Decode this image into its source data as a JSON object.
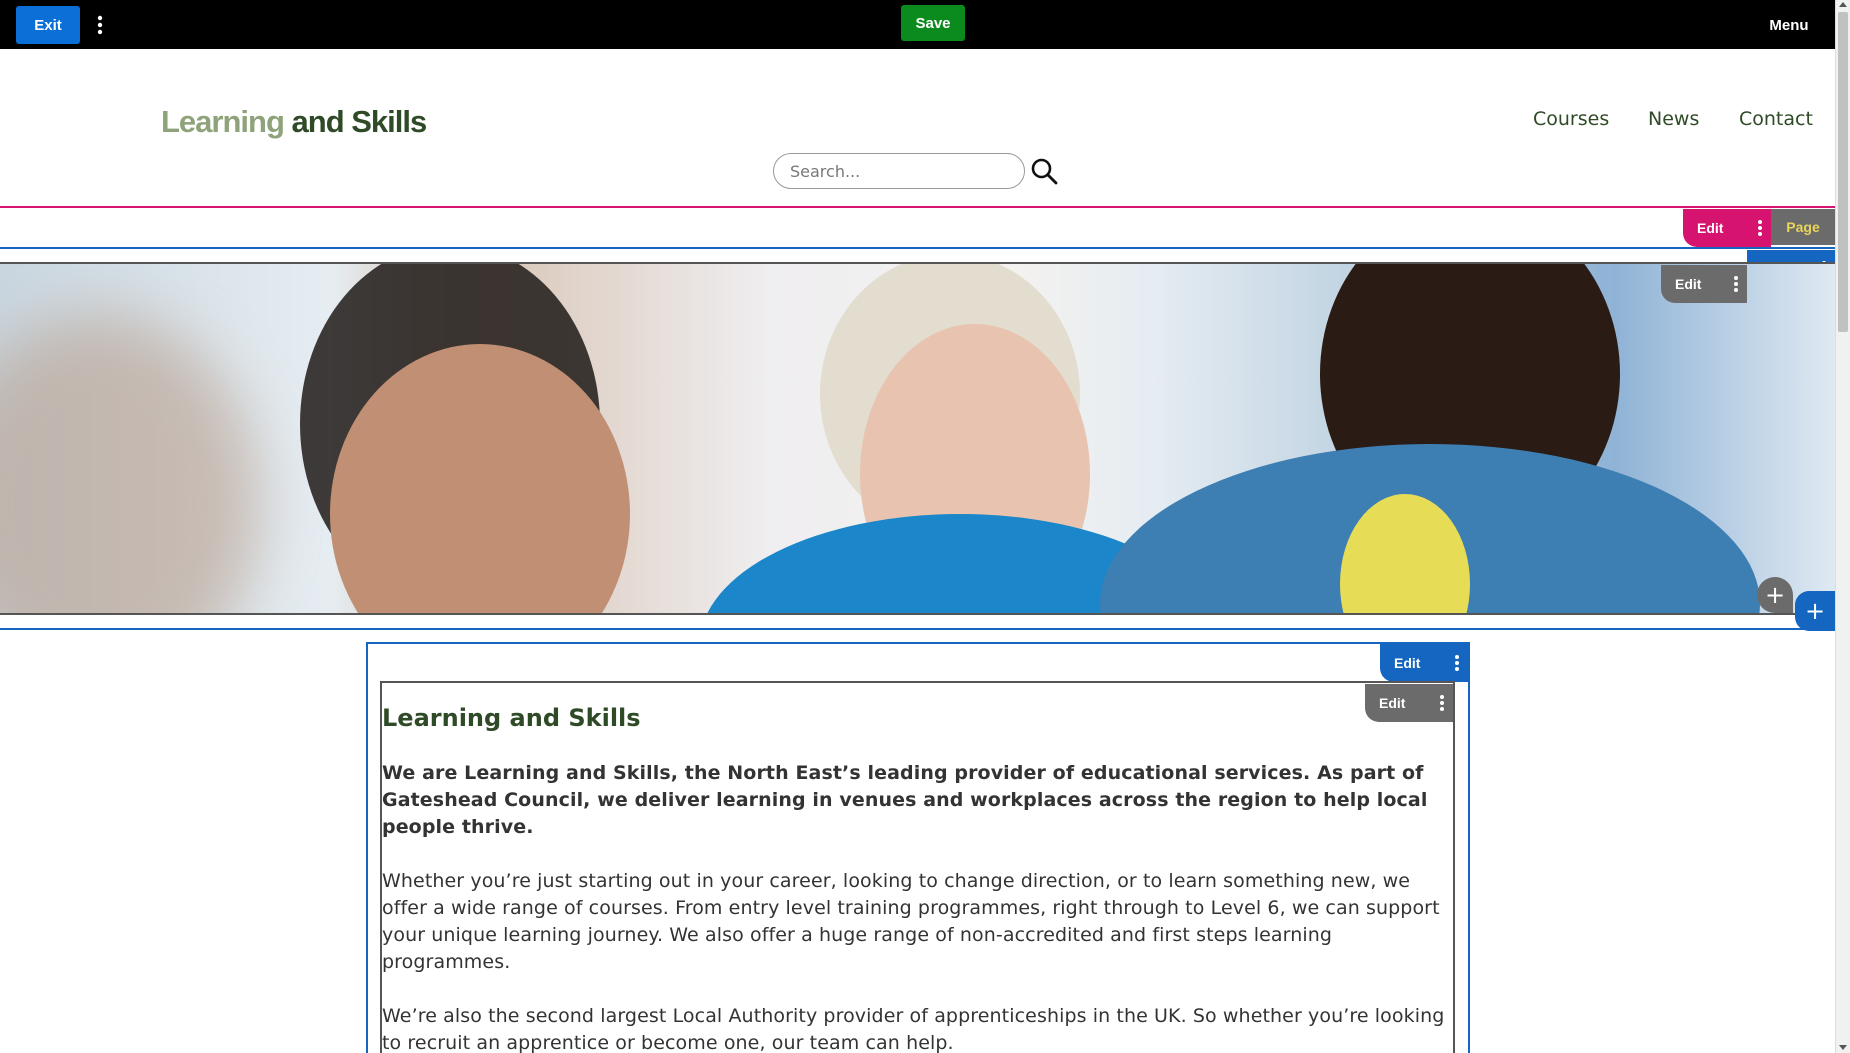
{
  "editor": {
    "exit_label": "Exit",
    "save_label": "Save",
    "menu_label": "Menu",
    "edit_label": "Edit",
    "page_label": "Page",
    "add_label": "+"
  },
  "site": {
    "logo_part1": "Learning",
    "logo_part2": " and Skills",
    "nav": [
      "Courses",
      "News",
      "Contact"
    ],
    "search_placeholder": "Search..."
  },
  "content": {
    "heading": "Learning and Skills",
    "lead": "We are Learning and Skills, the North East’s leading provider of educational services. As part of Gateshead Council, we deliver learning in venues and workplaces across the region to help local people thrive.",
    "paragraph1": "Whether you’re just starting out in your career, looking to change direction, or to learn something new, we offer a wide range of courses. From entry level training programmes, right through to Level 6, we can support your unique learning journey. We also offer a huge range of non-accredited and first steps learning programmes.",
    "paragraph2": "We’re also the second largest Local Authority provider of apprenticeships in the UK. So whether you’re looking to recruit an apprentice or become one, our team can help."
  },
  "colors": {
    "editor_blue": "#1566c0",
    "save_green": "#0b8a1e",
    "pink": "#d6136e",
    "brand_dark_green": "#2f4a26",
    "brand_light_green": "#8fa37a"
  }
}
